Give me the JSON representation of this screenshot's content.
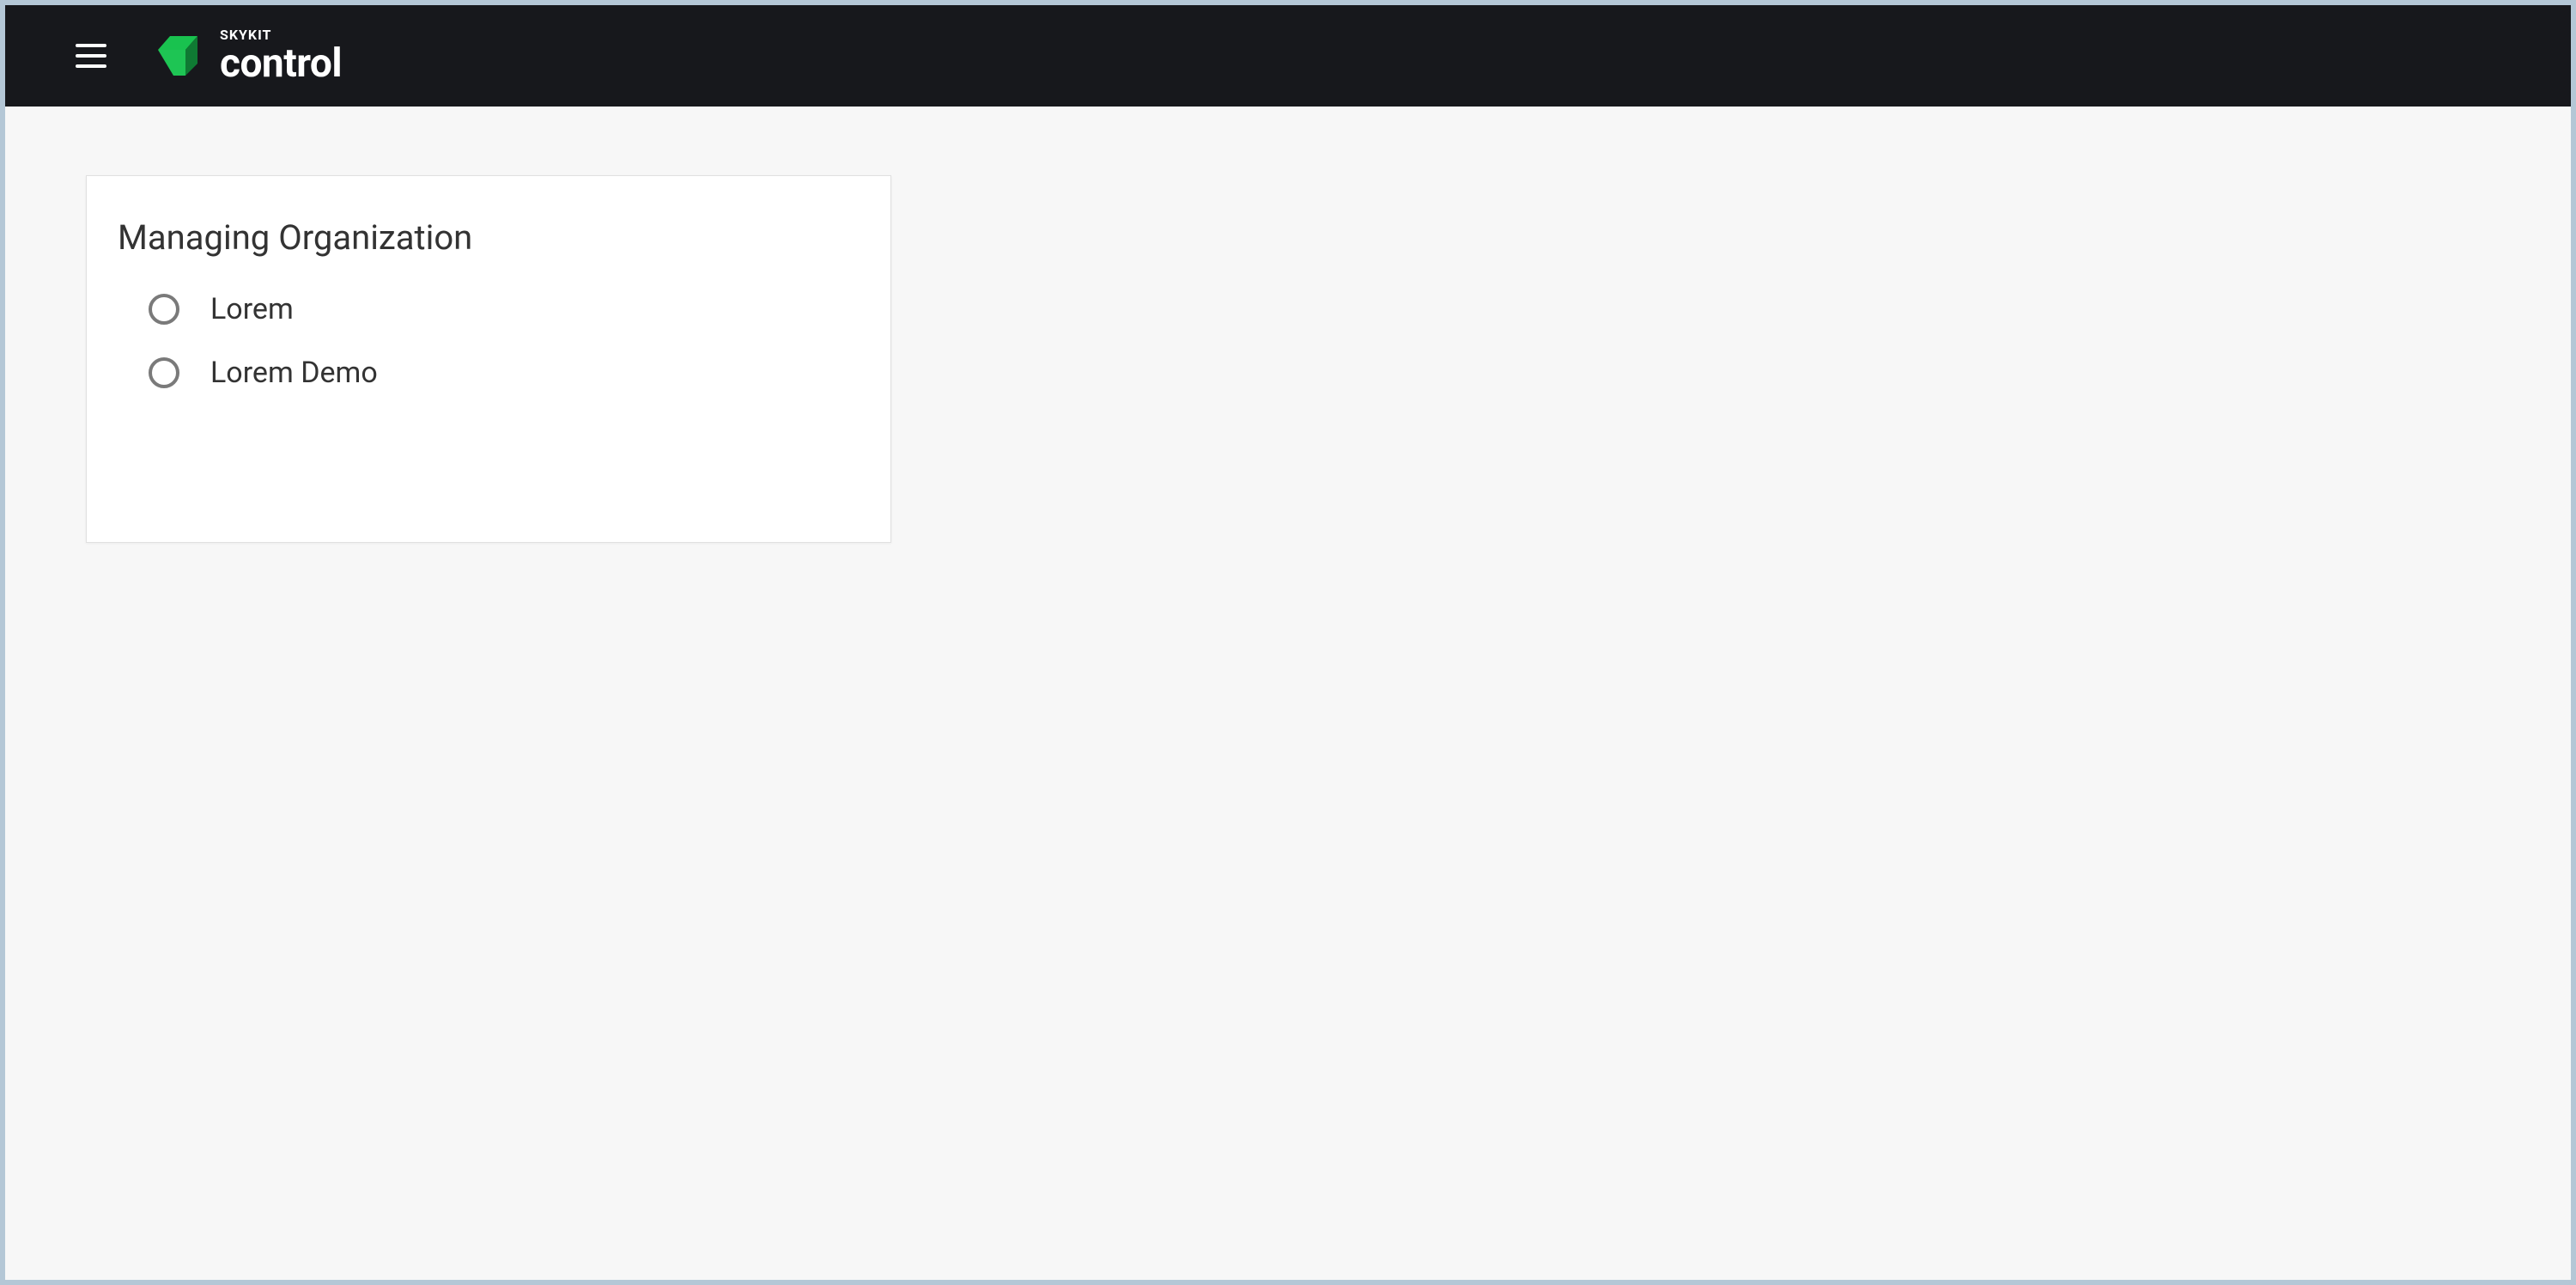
{
  "header": {
    "brand_small": "SKYKIT",
    "brand_large": "control"
  },
  "card": {
    "title": "Managing Organization",
    "options": [
      {
        "label": "Lorem"
      },
      {
        "label": "Lorem Demo"
      }
    ]
  },
  "colors": {
    "header_bg": "#17181c",
    "accent_green": "#1ec554",
    "accent_green_dark": "#0f7a33",
    "frame_border": "#b4c7d6"
  }
}
